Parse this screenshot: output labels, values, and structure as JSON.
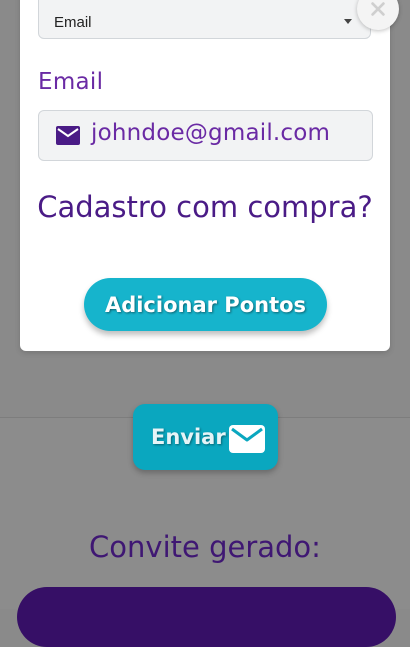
{
  "modal": {
    "select": {
      "value": "Email"
    },
    "email_label": "Email",
    "email_input": {
      "value": "johndoe@gmail.com"
    },
    "question": "Cadastro com compra?",
    "add_points_label": "Adicionar Pontos"
  },
  "send_button": {
    "label": "Enviar"
  },
  "invite": {
    "title": "Convite gerado:"
  },
  "colors": {
    "primary_purple": "#4a1b86",
    "accent_cyan": "#16b4cc",
    "dark_purple": "#360f66"
  },
  "icons": {
    "close": "close-icon",
    "input_mail": "mail-icon",
    "send_mail": "mail-icon"
  }
}
